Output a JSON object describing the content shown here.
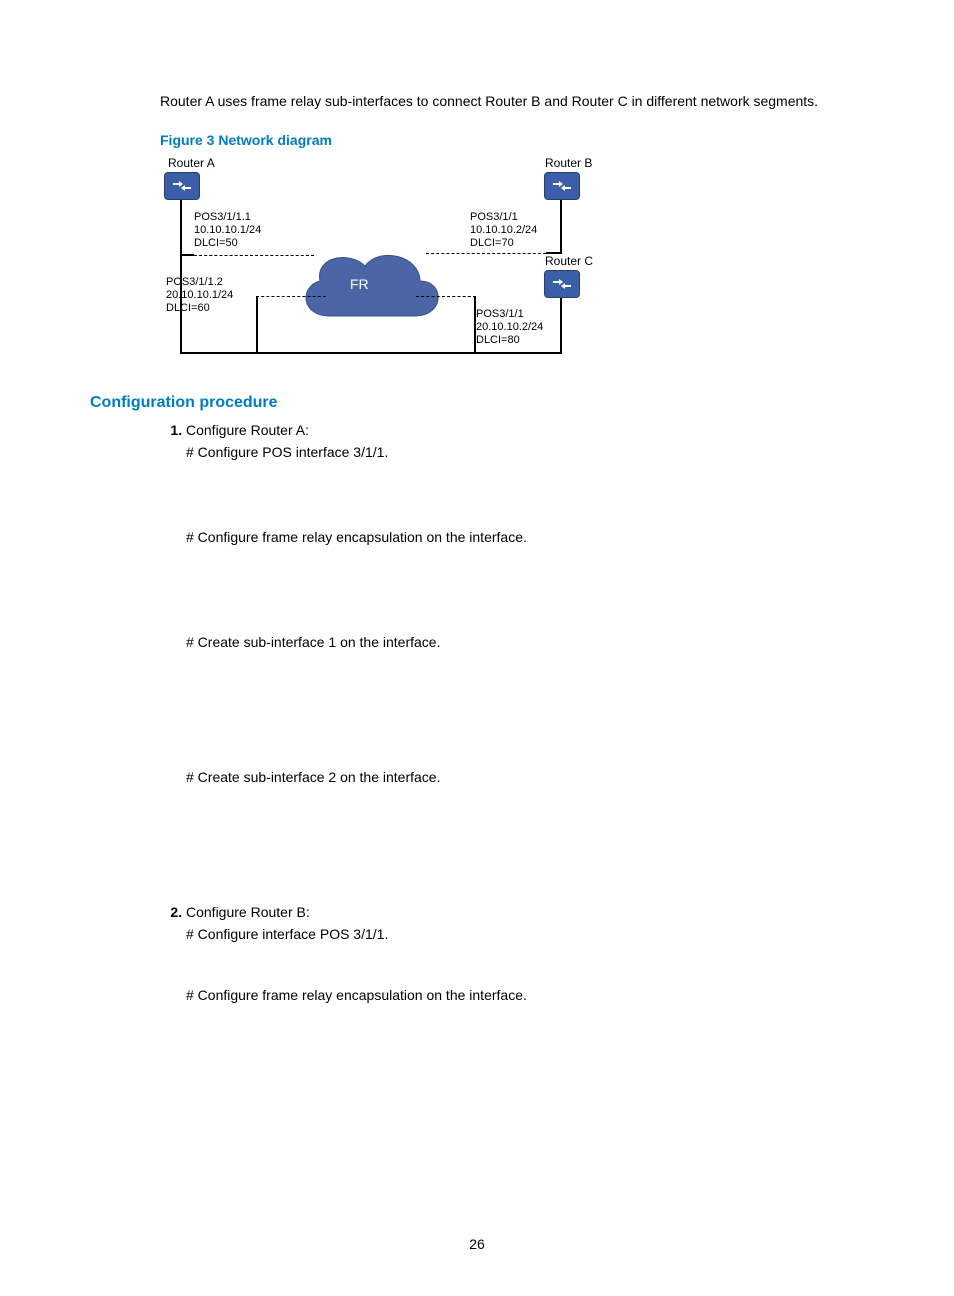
{
  "intro": "Router A uses frame relay sub-interfaces to connect Router B and Router C in different network segments.",
  "figure_caption": "Figure 3 Network diagram",
  "diagram": {
    "router_a": "Router A",
    "router_b": "Router B",
    "router_c": "Router C",
    "fr": "FR",
    "a1": {
      "if": "POS3/1/1.1",
      "ip": "10.10.10.1/24",
      "dlci": "DLCI=50"
    },
    "a2": {
      "if": "POS3/1/1.2",
      "ip": "20.10.10.1/24",
      "dlci": "DLCI=60"
    },
    "b": {
      "if": "POS3/1/1",
      "ip": "10.10.10.2/24",
      "dlci": "DLCI=70"
    },
    "c": {
      "if": "POS3/1/1",
      "ip": "20.10.10.2/24",
      "dlci": "DLCI=80"
    }
  },
  "section": "Configuration procedure",
  "steps": [
    {
      "title": "Configure Router A:",
      "subs": [
        "# Configure POS interface 3/1/1.",
        "# Configure frame relay encapsulation on the interface.",
        "# Create sub-interface 1 on the interface.",
        "# Create sub-interface 2 on the interface."
      ]
    },
    {
      "title": "Configure Router B:",
      "subs": [
        "# Configure interface POS 3/1/1.",
        "# Configure frame relay encapsulation on the interface."
      ]
    }
  ],
  "page_number": "26"
}
